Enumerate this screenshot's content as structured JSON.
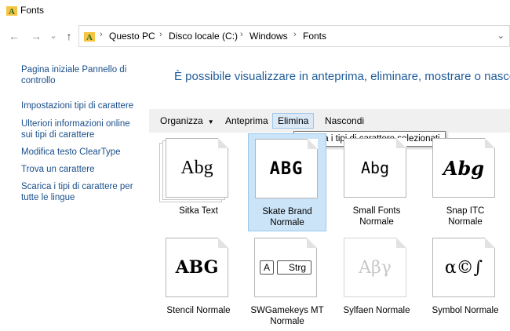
{
  "window": {
    "title": "Fonts"
  },
  "nav": {
    "back": "←",
    "forward": "→",
    "recent": "⌄",
    "up": "↑",
    "breadcrumb": [
      "Questo PC",
      "Disco locale (C:)",
      "Windows",
      "Fonts"
    ],
    "separator": "›",
    "dropdown": "⌄"
  },
  "sidebar": {
    "links": [
      "Pagina iniziale Pannello di controllo",
      "Impostazioni tipi di carattere",
      "Ulteriori informazioni online sui tipi di carattere",
      "Modifica testo ClearType",
      "Trova un carattere",
      "Scarica i tipi di carattere per tutte le lingue"
    ]
  },
  "main": {
    "heading": "È possibile visualizzare in anteprima, eliminare, mostrare o nasco"
  },
  "toolbar": {
    "organize": "Organizza",
    "preview": "Anteprima",
    "delete": "Elimina",
    "hide": "Nascondi",
    "tooltip": "Elimina i tipi di carattere selezionati"
  },
  "fonts": [
    {
      "sample": "Abg",
      "name": "Sitka Text",
      "style": ""
    },
    {
      "sample": "ABG",
      "name": "Skate Brand",
      "style": "Normale"
    },
    {
      "sample": "Abg",
      "name": "Small Fonts",
      "style": "Normale"
    },
    {
      "sample": "Abg",
      "name": "Snap ITC",
      "style": "Normale"
    },
    {
      "sample": "ABG",
      "name": "Stencil Normale",
      "style": ""
    },
    {
      "sample_a": "A",
      "sample_b": "Strg",
      "name": "SWGamekeys MT",
      "style": "Normale"
    },
    {
      "sample": "Aβγ",
      "name": "Sylfaen Normale",
      "style": ""
    },
    {
      "sample": "α©∫",
      "name": "Symbol Normale",
      "style": ""
    }
  ],
  "colors": {
    "link": "#1a4f8a",
    "heading": "#1f5c99",
    "selected": "#cce4f7"
  }
}
